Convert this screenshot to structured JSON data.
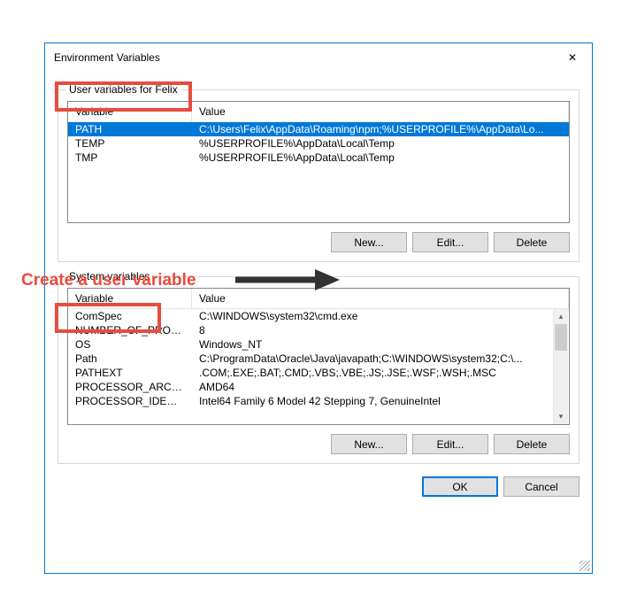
{
  "dialog": {
    "title": "Environment Variables",
    "close": "✕"
  },
  "user_section": {
    "label": "User variables for Felix",
    "headers": {
      "variable": "Variable",
      "value": "Value"
    },
    "rows": [
      {
        "variable": "PATH",
        "value": "C:\\Users\\Felix\\AppData\\Roaming\\npm;%USERPROFILE%\\AppData\\Lo..."
      },
      {
        "variable": "TEMP",
        "value": "%USERPROFILE%\\AppData\\Local\\Temp"
      },
      {
        "variable": "TMP",
        "value": "%USERPROFILE%\\AppData\\Local\\Temp"
      }
    ],
    "buttons": {
      "new": "New...",
      "edit": "Edit...",
      "delete": "Delete"
    }
  },
  "system_section": {
    "label": "System variables",
    "headers": {
      "variable": "Variable",
      "value": "Value"
    },
    "rows": [
      {
        "variable": "ComSpec",
        "value": "C:\\WINDOWS\\system32\\cmd.exe"
      },
      {
        "variable": "NUMBER_OF_PROCESSORS",
        "value": "8"
      },
      {
        "variable": "OS",
        "value": "Windows_NT"
      },
      {
        "variable": "Path",
        "value": "C:\\ProgramData\\Oracle\\Java\\javapath;C:\\WINDOWS\\system32;C:\\..."
      },
      {
        "variable": "PATHEXT",
        "value": ".COM;.EXE;.BAT;.CMD;.VBS;.VBE;.JS;.JSE;.WSF;.WSH;.MSC"
      },
      {
        "variable": "PROCESSOR_ARCHITECTURE",
        "value": "AMD64"
      },
      {
        "variable": "PROCESSOR_IDENTIFIER",
        "value": "Intel64 Family 6 Model 42 Stepping 7, GenuineIntel"
      }
    ],
    "buttons": {
      "new": "New...",
      "edit": "Edit...",
      "delete": "Delete"
    }
  },
  "bottom": {
    "ok": "OK",
    "cancel": "Cancel"
  },
  "annotation": {
    "text": "Create a user variable"
  }
}
